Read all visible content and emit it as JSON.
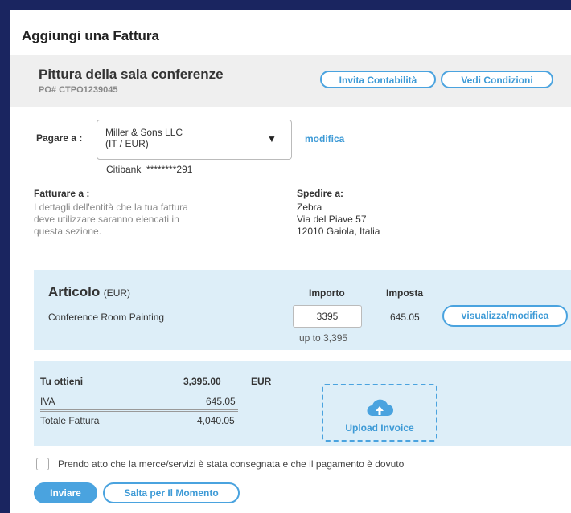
{
  "modal": {
    "title": "Aggiungi una Fattura"
  },
  "project": {
    "title": "Pittura della sala conferenze",
    "po": "PO# CTPO1239045",
    "invite_label": "Invita Contabilità",
    "terms_label": "Vedi Condizioni"
  },
  "payee": {
    "label": "Pagare a :",
    "selected_line1": "Miller & Sons LLC",
    "selected_line2": "(IT / EUR)",
    "edit_link": "modifica",
    "bank": "Citibank",
    "account_masked": "********291"
  },
  "bill_to": {
    "label": "Fatturare a :",
    "text_line1": "I dettagli dell'entità che la tua fattura",
    "text_line2": "deve utilizzare saranno elencati in",
    "text_line3": "questa sezione."
  },
  "ship_to": {
    "label": "Spedire a:",
    "line1": "Zebra",
    "line2": "Via del Piave 57",
    "line3": "12010 Gaiola, Italia"
  },
  "items": {
    "header_item": "Articolo",
    "header_currency": "(EUR)",
    "header_amount": "Importo",
    "header_tax": "Imposta",
    "row_description": "Conference Room Painting",
    "row_amount_value": "3395",
    "row_amount_hint": "up to 3,395",
    "row_tax": "645.05",
    "row_action": "visualizza/modifica"
  },
  "summary": {
    "you_get_label": "Tu ottieni",
    "you_get_value": "3,395.00",
    "currency": "EUR",
    "vat_label": "IVA",
    "vat_value": "645.05",
    "total_label": "Totale Fattura",
    "total_value": "4,040.05",
    "upload_label": "Upload Invoice",
    "upload_icon": "cloud-upload-icon"
  },
  "acknowledge": {
    "text": "Prendo atto che la merce/servizi è stata consegnata e che il pagamento è dovuto",
    "checked": false
  },
  "actions": {
    "submit_label": "Inviare",
    "skip_label": "Salta per Il Momento"
  },
  "colors": {
    "accent": "#4aa3df",
    "band": "#ddeef8",
    "frame": "#1a2560"
  }
}
